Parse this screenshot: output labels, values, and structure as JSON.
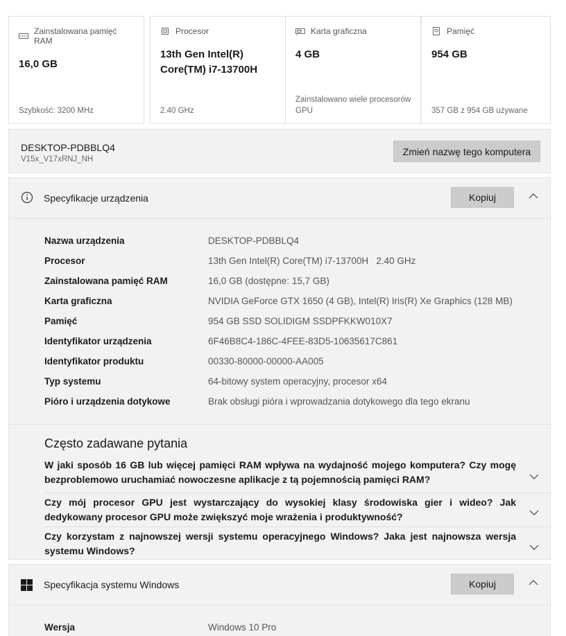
{
  "cards": [
    {
      "icon": "ram-icon",
      "label": "Zainstalowana pamięć RAM",
      "value": "16,0 GB",
      "sub": "Szybkość: 3200 MHz"
    },
    {
      "icon": "processor-icon",
      "label": "Procesor",
      "value": "13th Gen Intel(R) Core(TM) i7-13700H",
      "sub": "2.40 GHz"
    },
    {
      "icon": "graphics-card-icon",
      "label": "Karta graficzna",
      "value": "4 GB",
      "sub": "Zainstalowano wiele procesorów GPU"
    },
    {
      "icon": "storage-icon",
      "label": "Pamięć",
      "value": "954 GB",
      "sub": "357 GB z 954 GB używane"
    }
  ],
  "pc": {
    "name": "DESKTOP-PDBBLQ4",
    "model": "V15x_V17xRNJ_NH",
    "rename_label": "Zmień nazwę tego komputera"
  },
  "device_specs": {
    "title": "Specyfikacje urządzenia",
    "copy_label": "Kopiuj",
    "rows": [
      {
        "k": "Nazwa urządzenia",
        "v": "DESKTOP-PDBBLQ4"
      },
      {
        "k": "Procesor",
        "v": "13th Gen Intel(R) Core(TM) i7-13700H   2.40 GHz"
      },
      {
        "k": "Zainstalowana pamięć RAM",
        "v": "16,0 GB (dostępne: 15,7 GB)"
      },
      {
        "k": "Karta graficzna",
        "v": "NVIDIA GeForce GTX 1650 (4 GB), Intel(R) Iris(R) Xe Graphics (128 MB)"
      },
      {
        "k": "Pamięć",
        "v": "954 GB SSD SOLIDIGM SSDPFKKW010X7"
      },
      {
        "k": "Identyfikator urządzenia",
        "v": "6F46B8C4-186C-4FEE-83D5-10635617C861"
      },
      {
        "k": "Identyfikator produktu",
        "v": "00330-80000-00000-AA005"
      },
      {
        "k": "Typ systemu",
        "v": "64-bitowy system operacyjny, procesor x64"
      },
      {
        "k": "Pióro i urządzenia dotykowe",
        "v": "Brak obsługi pióra i wprowadzania dotykowego dla tego ekranu"
      }
    ]
  },
  "faq": {
    "title": "Często zadawane pytania",
    "items": [
      {
        "q": "W jaki sposób 16 GB lub więcej pamięci RAM wpływa na wydajność mojego komputera? Czy mogę bezproblemowo uruchamiać nowoczesne aplikacje z tą pojemnością pamięci RAM?"
      },
      {
        "q": "Czy mój procesor GPU jest wystarczający do wysokiej klasy środowiska gier i wideo? Jak dedykowany procesor GPU może zwiększyć moje wrażenia i produktywność?"
      },
      {
        "q": "Czy korzystam z najnowszej wersji systemu operacyjnego Windows? Jaka jest najnowsza wersja systemu Windows?"
      }
    ]
  },
  "windows_specs": {
    "title": "Specyfikacja systemu Windows",
    "copy_label": "Kopiuj",
    "rows": [
      {
        "k": "Wersja",
        "v": "Windows 10 Pro"
      }
    ]
  }
}
